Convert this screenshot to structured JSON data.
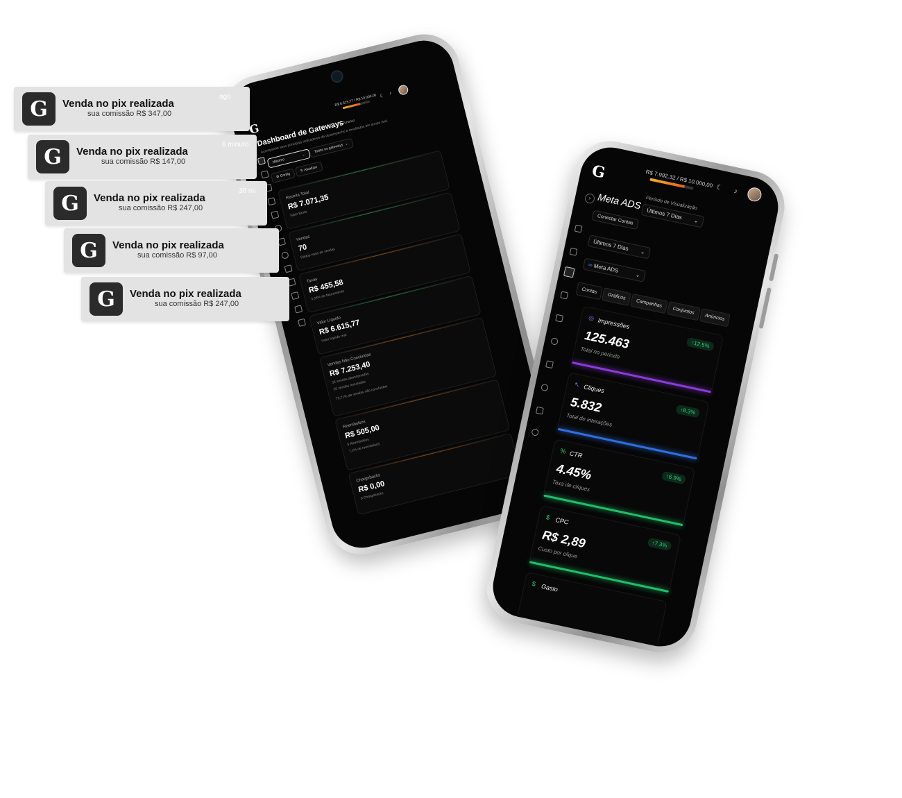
{
  "notifications": [
    {
      "title": "Venda no pix realizada",
      "subtitle": "sua comissão R$ 347,00",
      "time": "ago"
    },
    {
      "title": "Venda no pix realizada",
      "subtitle": "sua comissão R$ 147,00",
      "time": "6 minuto"
    },
    {
      "title": "Venda no pix realizada",
      "subtitle": "sua comissão R$ 247,00",
      "time": "30 mi"
    },
    {
      "title": "Venda no pix realizada",
      "subtitle": "sua comissão R$ 97,00",
      "time": ""
    },
    {
      "title": "Venda no pix realizada",
      "subtitle": "sua comissão R$ 247,00",
      "time": ""
    }
  ],
  "brand_glyph": "G",
  "left_phone": {
    "progress_text": "R$ 6.615,77 / R$ 10.000,00",
    "progress_fraction": 0.66,
    "page_title": "Dashboard de Gateways",
    "status": "Timeout",
    "description": "Acompanhe seus principais indicadores de desempenho e resultados em tempo real.",
    "filter_period": "Máximo",
    "filter_gateway": "Todos os gateways",
    "btn_config": "Config",
    "btn_refresh": "Atualizar",
    "cards": [
      {
        "label": "Receita Total",
        "value": "R$ 7.071,35",
        "sub": "Valor Bruto",
        "sub2": "",
        "sub3": "",
        "accent": "#2b7a3c"
      },
      {
        "label": "Vendas",
        "value": "70",
        "sub": "Dados reais de vendas",
        "sub2": "",
        "sub3": "",
        "accent": "#2b7a3c"
      },
      {
        "label": "Taxas",
        "value": "R$ 455,58",
        "sub": "3,94% do faturamento",
        "sub2": "",
        "sub3": "",
        "accent": "#8a4a1a"
      },
      {
        "label": "Valor Líquido",
        "value": "R$ 6.615,77",
        "sub": "Valor líquido real",
        "sub2": "",
        "sub3": "",
        "accent": "#2b7a3c"
      },
      {
        "label": "Vendas Não Concluídas",
        "value": "R$ 7.253,40",
        "sub": "33 vendas abandonadas",
        "sub2": "20 vendas recusadas",
        "sub3": "75,71% de vendas não concluídas",
        "accent": "#8a4a1a"
      },
      {
        "label": "Reembolsos",
        "value": "R$ 505,00",
        "sub": "5 Reembolsos",
        "sub2": "7,1% de reembolsos",
        "sub3": "",
        "accent": "#8a4a1a"
      },
      {
        "label": "Chargebacks",
        "value": "R$ 0,00",
        "sub": "0 Chargebacks",
        "sub2": "",
        "sub3": "",
        "accent": "#8a4a1a"
      }
    ]
  },
  "right_phone": {
    "progress_text": "R$ 7.992,32 / R$ 10.000,00",
    "progress_fraction": 0.8,
    "page_title": "Meta ADS",
    "period_label": "Período de Visualização",
    "period_value": "Últimos 7 Dias",
    "connect_label": "Conectar Contas",
    "range_value": "Últimos 7 Dias",
    "platform_value": "Meta ADS",
    "tabs": [
      "Contas",
      "Gráficos",
      "Campanhas",
      "Conjuntos",
      "Anúncios"
    ],
    "metrics": [
      {
        "icon": "◎",
        "label": "Impressões",
        "value": "125.463",
        "sub": "Total no período",
        "badge": "↑12.5%",
        "color": "#8b3bd9",
        "icon_color": "#9b6bff"
      },
      {
        "icon": "↖",
        "label": "Cliques",
        "value": "5.832",
        "sub": "Total de interações",
        "badge": "↑8.3%",
        "color": "#2f6fe0",
        "icon_color": "#5a8cff"
      },
      {
        "icon": "%",
        "label": "CTR",
        "value": "4.45%",
        "sub": "Taxa de cliques",
        "badge": "↑6.9%",
        "color": "#1fbf6a",
        "icon_color": "#2ecf7a"
      },
      {
        "icon": "$",
        "label": "CPC",
        "value": "R$ 2,89",
        "sub": "Custo por clique",
        "badge": "↑7.3%",
        "color": "#1fbf6a",
        "icon_color": "#2ecf7a"
      },
      {
        "icon": "$",
        "label": "Gasto",
        "value": "",
        "sub": "",
        "badge": "",
        "color": "#1fbf6a",
        "icon_color": "#2ecf7a"
      }
    ]
  }
}
